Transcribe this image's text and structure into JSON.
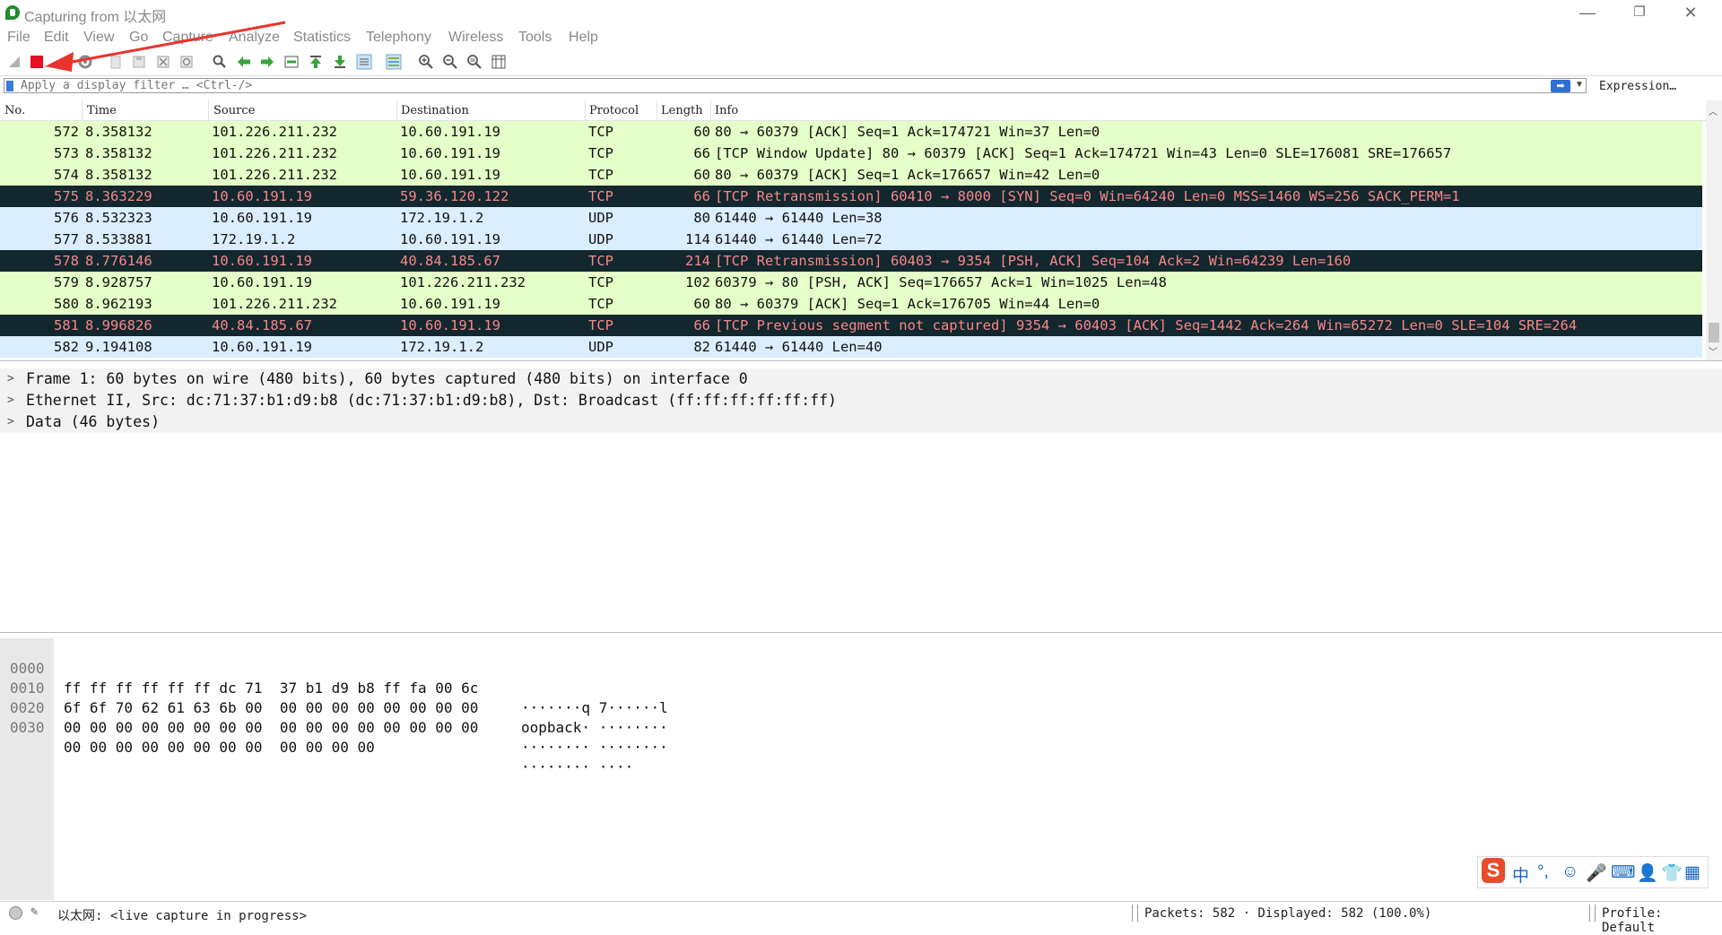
{
  "window": {
    "title": "Capturing from 以太网",
    "minimize": "—",
    "restore": "❐",
    "close": "✕"
  },
  "menu": [
    "File",
    "Edit",
    "View",
    "Go",
    "Capture",
    "Analyze",
    "Statistics",
    "Telephony",
    "Wireless",
    "Tools",
    "Help"
  ],
  "filter": {
    "placeholder": "Apply a display filter … <Ctrl-/>",
    "apply_icon": "arrow-right-icon",
    "expression_label": "Expression…"
  },
  "packet_list": {
    "columns": [
      "No.",
      "Time",
      "Source",
      "Destination",
      "Protocol",
      "Length",
      "Info"
    ],
    "row_colors": {
      "tcp": "#e4ffc7",
      "udp": "#daeeff",
      "bad_bg": "#12272e",
      "bad_fg": "#f78787"
    },
    "rows": [
      {
        "no": "572",
        "time": "8.358132",
        "src": "101.226.211.232",
        "dst": "10.60.191.19",
        "proto": "TCP",
        "len": "60",
        "info": "80 → 60379 [ACK] Seq=1 Ack=174721 Win=37 Len=0",
        "style": "tcp"
      },
      {
        "no": "573",
        "time": "8.358132",
        "src": "101.226.211.232",
        "dst": "10.60.191.19",
        "proto": "TCP",
        "len": "66",
        "info": "[TCP Window Update] 80 → 60379 [ACK] Seq=1 Ack=174721 Win=43 Len=0 SLE=176081 SRE=176657",
        "style": "tcp"
      },
      {
        "no": "574",
        "time": "8.358132",
        "src": "101.226.211.232",
        "dst": "10.60.191.19",
        "proto": "TCP",
        "len": "60",
        "info": "80 → 60379 [ACK] Seq=1 Ack=176657 Win=42 Len=0",
        "style": "tcp"
      },
      {
        "no": "575",
        "time": "8.363229",
        "src": "10.60.191.19",
        "dst": "59.36.120.122",
        "proto": "TCP",
        "len": "66",
        "info": "[TCP Retransmission] 60410 → 8000 [SYN] Seq=0 Win=64240 Len=0 MSS=1460 WS=256 SACK_PERM=1",
        "style": "bad"
      },
      {
        "no": "576",
        "time": "8.532323",
        "src": "10.60.191.19",
        "dst": "172.19.1.2",
        "proto": "UDP",
        "len": "80",
        "info": "61440 → 61440 Len=38",
        "style": "udp"
      },
      {
        "no": "577",
        "time": "8.533881",
        "src": "172.19.1.2",
        "dst": "10.60.191.19",
        "proto": "UDP",
        "len": "114",
        "info": "61440 → 61440 Len=72",
        "style": "udp"
      },
      {
        "no": "578",
        "time": "8.776146",
        "src": "10.60.191.19",
        "dst": "40.84.185.67",
        "proto": "TCP",
        "len": "214",
        "info": "[TCP Retransmission] 60403 → 9354 [PSH, ACK] Seq=104 Ack=2 Win=64239 Len=160",
        "style": "bad"
      },
      {
        "no": "579",
        "time": "8.928757",
        "src": "10.60.191.19",
        "dst": "101.226.211.232",
        "proto": "TCP",
        "len": "102",
        "info": "60379 → 80 [PSH, ACK] Seq=176657 Ack=1 Win=1025 Len=48",
        "style": "tcp"
      },
      {
        "no": "580",
        "time": "8.962193",
        "src": "101.226.211.232",
        "dst": "10.60.191.19",
        "proto": "TCP",
        "len": "60",
        "info": "80 → 60379 [ACK] Seq=1 Ack=176705 Win=44 Len=0",
        "style": "tcp"
      },
      {
        "no": "581",
        "time": "8.996826",
        "src": "40.84.185.67",
        "dst": "10.60.191.19",
        "proto": "TCP",
        "len": "66",
        "info": "[TCP Previous segment not captured] 9354 → 60403 [ACK] Seq=1442 Ack=264 Win=65272 Len=0 SLE=104 SRE=264",
        "style": "bad"
      },
      {
        "no": "582",
        "time": "9.194108",
        "src": "10.60.191.19",
        "dst": "172.19.1.2",
        "proto": "UDP",
        "len": "82",
        "info": "61440 → 61440 Len=40",
        "style": "udp"
      }
    ]
  },
  "details": [
    "Frame 1: 60 bytes on wire (480 bits), 60 bytes captured (480 bits) on interface 0",
    "Ethernet II, Src: dc:71:37:b1:d9:b8 (dc:71:37:b1:d9:b8), Dst: Broadcast (ff:ff:ff:ff:ff:ff)",
    "Data (46 bytes)"
  ],
  "bytes": [
    {
      "offset": "0000",
      "hex": "ff ff ff ff ff ff dc 71  37 b1 d9 b8 ff fa 00 6c",
      "ascii": "·······q 7······l"
    },
    {
      "offset": "0010",
      "hex": "6f 6f 70 62 61 63 6b 00  00 00 00 00 00 00 00 00",
      "ascii": "oopback· ········"
    },
    {
      "offset": "0020",
      "hex": "00 00 00 00 00 00 00 00  00 00 00 00 00 00 00 00",
      "ascii": "········ ········"
    },
    {
      "offset": "0030",
      "hex": "00 00 00 00 00 00 00 00  00 00 00 00",
      "ascii": "········ ····"
    }
  ],
  "ime": {
    "logo": "S",
    "lang": "中",
    "punct": "°,",
    "emoji": "☺",
    "mic": "🎤",
    "keyboard": "⌨",
    "user": "👤",
    "shirt": "👕",
    "grid": "▦"
  },
  "status": {
    "interface_text": "以太网: <live capture in progress>",
    "packets_text": "Packets: 582 · Displayed: 582 (100.0%)",
    "profile_text": "Profile: Default"
  },
  "accent": {
    "stop_red": "#e81123",
    "annotation_red": "#e8342d"
  }
}
